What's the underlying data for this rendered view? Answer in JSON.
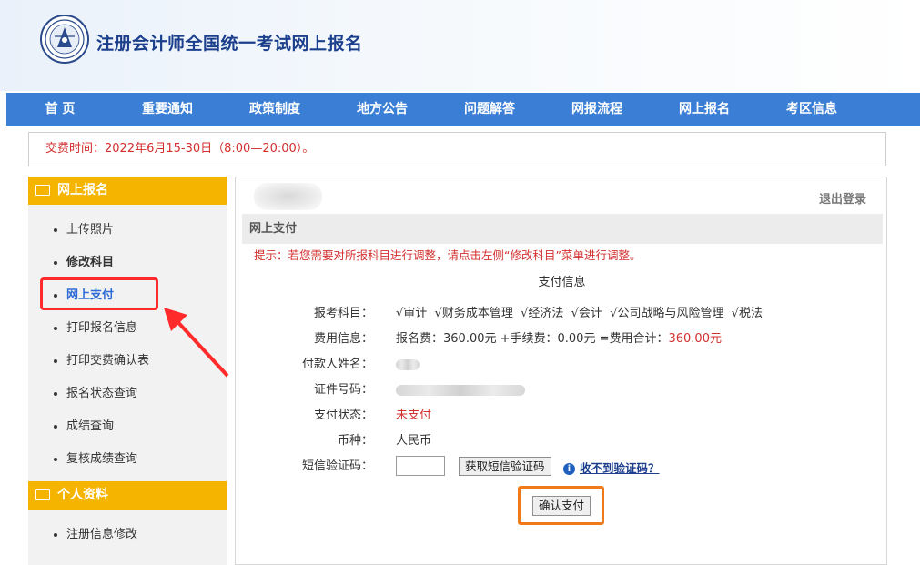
{
  "header": {
    "title": "注册会计师全国统一考试网上报名",
    "logo_icon": "cicpa-emblem-icon"
  },
  "nav": [
    {
      "label": "首 页"
    },
    {
      "label": "重要通知"
    },
    {
      "label": "政策制度"
    },
    {
      "label": "地方公告"
    },
    {
      "label": "问题解答"
    },
    {
      "label": "网报流程"
    },
    {
      "label": "网上报名"
    },
    {
      "label": "考区信息"
    }
  ],
  "notice": "交费时间：2022年6月15-30日（8:00—20:00）。",
  "sidebar": {
    "section1": {
      "title": "网上报名",
      "icon": "monitor-icon",
      "items": [
        {
          "label": "上传照片"
        },
        {
          "label": "修改科目"
        },
        {
          "label": "网上支付"
        },
        {
          "label": "打印报名信息"
        },
        {
          "label": "打印交费确认表"
        },
        {
          "label": "报名状态查询"
        },
        {
          "label": "成绩查询"
        },
        {
          "label": "复核成绩查询"
        }
      ]
    },
    "section2": {
      "title": "个人资料",
      "icon": "id-card-icon",
      "items": [
        {
          "label": "注册信息修改"
        }
      ]
    }
  },
  "main": {
    "logout": "退出登录",
    "section_title": "网上支付",
    "tip": "提示：若您需要对所报科目进行调整，请点击左侧“修改科目”菜单进行调整。",
    "payment_title": "支付信息",
    "fields": {
      "subjects_label": "报考科目：",
      "subjects_value": "√审计  √财务成本管理  √经济法  √会计  √公司战略与风险管理  √税法",
      "fee_label": "费用信息：",
      "fee_value": "报名费：360.00元 +手续费：0.00元 =费用合计：",
      "fee_total": "360.00元",
      "payer_label": "付款人姓名：",
      "id_label": "证件号码：",
      "status_label": "支付状态：",
      "status_value": "未支付",
      "currency_label": "币种：",
      "currency_value": "人民币",
      "sms_label": "短信验证码："
    },
    "get_code_button": "获取短信验证码",
    "help_link": "收不到验证码？",
    "help_icon": "info-icon",
    "confirm_button": "确认支付"
  },
  "colors": {
    "nav_bg": "#3a7fd5",
    "sidebar_header": "#f4b400",
    "alert_red": "#d32f2f",
    "highlight_red": "#ff2a2a",
    "highlight_orange": "#f07a1a",
    "active_link": "#2d6bd6"
  }
}
